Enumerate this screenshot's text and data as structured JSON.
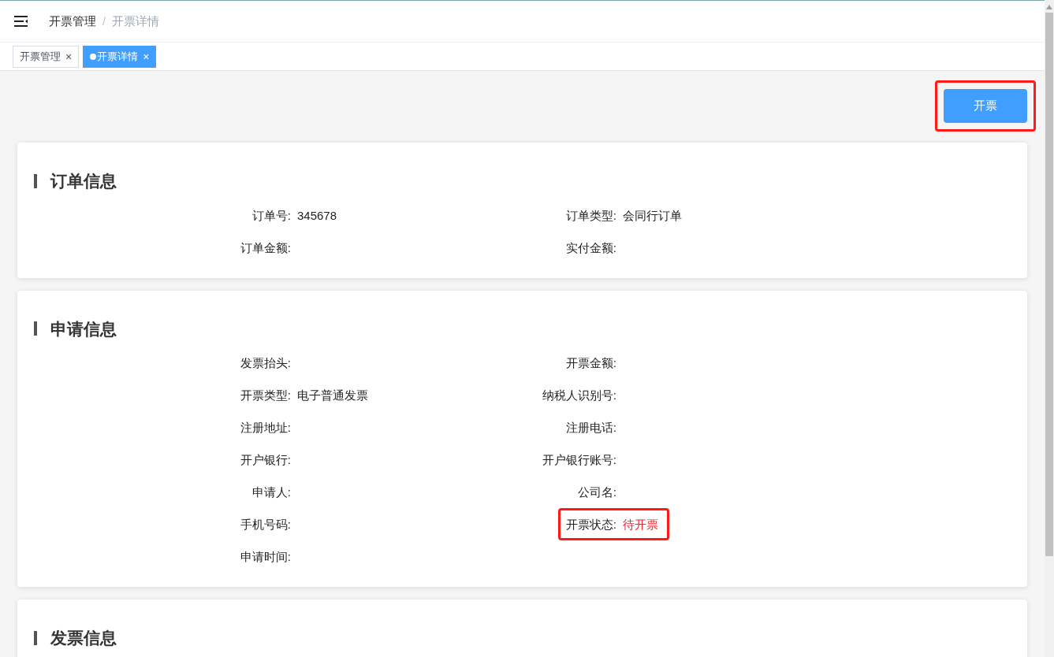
{
  "breadcrumb": [
    {
      "label": "开票管理",
      "current": false
    },
    {
      "label": "/",
      "current": false
    },
    {
      "label": "开票详情",
      "current": true
    }
  ],
  "tabs": [
    {
      "label": "开票管理",
      "selected": false,
      "close": "×"
    },
    {
      "label": "开票详情",
      "selected": true,
      "close": "×"
    }
  ],
  "action_button": {
    "label": "开票",
    "highlighted": true
  },
  "sections": [
    {
      "title": "订单信息",
      "fields": [
        {
          "label": "订单号:",
          "value": "345678",
          "highlighted": false
        },
        {
          "label": "订单类型:",
          "value": "会同行订单",
          "highlighted": false
        },
        {
          "label": "订单金额:",
          "highlighted": false
        },
        {
          "label": "实付金额:",
          "highlighted": false
        }
      ]
    },
    {
      "title": "申请信息",
      "fields": [
        {
          "label": "发票抬头:",
          "highlighted": false
        },
        {
          "label": "开票金额:",
          "highlighted": false
        },
        {
          "label": "开票类型:",
          "value": "电子普通发票",
          "highlighted": false
        },
        {
          "label": "纳税人识别号:",
          "highlighted": false
        },
        {
          "label": "注册地址:",
          "highlighted": false
        },
        {
          "label": "注册电话:",
          "highlighted": false
        },
        {
          "label": "开户银行:",
          "highlighted": false
        },
        {
          "label": "开户银行账号:",
          "highlighted": false
        },
        {
          "label": "申请人:",
          "highlighted": false
        },
        {
          "label": "公司名:",
          "highlighted": false
        },
        {
          "label": "手机号码:",
          "highlighted": false
        },
        {
          "label": "开票状态:",
          "value": "待开票",
          "color": "#f5222d",
          "highlighted": true
        },
        {
          "label": "申请时间:",
          "highlighted": false
        }
      ]
    },
    {
      "title": "发票信息"
    }
  ]
}
